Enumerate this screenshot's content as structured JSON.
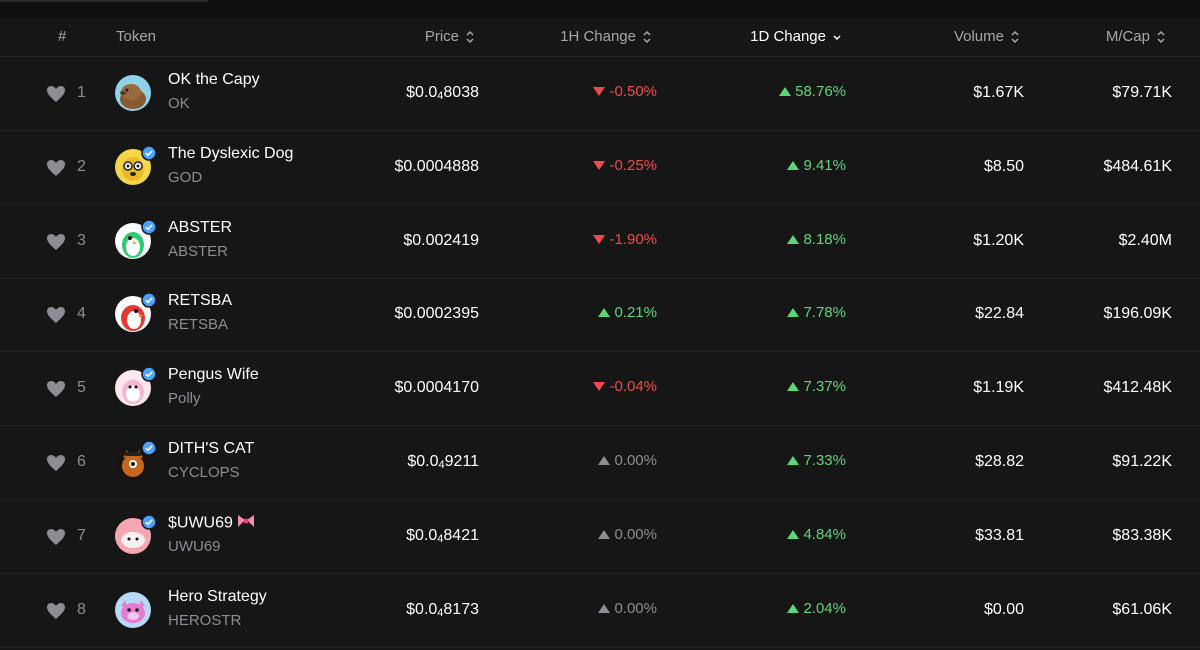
{
  "header": {
    "rank": "#",
    "token": "Token",
    "price": "Price",
    "change_1h": "1H Change",
    "change_1d": "1D Change",
    "volume": "Volume",
    "mcap": "M/Cap"
  },
  "colors": {
    "positive": "#5fd57a",
    "negative": "#f04a4a",
    "neutral": "#8d8d94",
    "verified": "#4aa3ff"
  },
  "rows": [
    {
      "rank": "1",
      "name": "OK the Capy",
      "symbol": "OK",
      "price_main": "$0.0",
      "price_sub": "4",
      "price_tail": "8038",
      "change_1h": "-0.50%",
      "change_1h_dir": "down",
      "change_1d": "58.76%",
      "change_1d_dir": "up",
      "volume": "$1.67K",
      "mcap": "$79.71K",
      "avatar_icon": "capybara-icon",
      "verified": false
    },
    {
      "rank": "2",
      "name": "The Dyslexic Dog",
      "symbol": "GOD",
      "price_main": "$0.0004888",
      "price_sub": "",
      "price_tail": "",
      "change_1h": "-0.25%",
      "change_1h_dir": "down",
      "change_1d": "9.41%",
      "change_1d_dir": "up",
      "volume": "$8.50",
      "mcap": "$484.61K",
      "avatar_icon": "dog-icon",
      "verified": true
    },
    {
      "rank": "3",
      "name": "ABSTER",
      "symbol": "ABSTER",
      "price_main": "$0.002419",
      "price_sub": "",
      "price_tail": "",
      "change_1h": "-1.90%",
      "change_1h_dir": "down",
      "change_1d": "8.18%",
      "change_1d_dir": "up",
      "volume": "$1.20K",
      "mcap": "$2.40M",
      "avatar_icon": "green-penguin-icon",
      "verified": true
    },
    {
      "rank": "4",
      "name": "RETSBA",
      "symbol": "RETSBA",
      "price_main": "$0.0002395",
      "price_sub": "",
      "price_tail": "",
      "change_1h": "0.21%",
      "change_1h_dir": "up",
      "change_1d": "7.78%",
      "change_1d_dir": "up",
      "volume": "$22.84",
      "mcap": "$196.09K",
      "avatar_icon": "red-penguin-icon",
      "verified": true
    },
    {
      "rank": "5",
      "name": "Pengus Wife",
      "symbol": "Polly",
      "price_main": "$0.0004170",
      "price_sub": "",
      "price_tail": "",
      "change_1h": "-0.04%",
      "change_1h_dir": "down",
      "change_1d": "7.37%",
      "change_1d_dir": "up",
      "volume": "$1.19K",
      "mcap": "$412.48K",
      "avatar_icon": "pink-penguin-icon",
      "verified": true
    },
    {
      "rank": "6",
      "name": "DITH'S CAT",
      "symbol": "CYCLOPS",
      "price_main": "$0.0",
      "price_sub": "4",
      "price_tail": "9211",
      "change_1h": "0.00%",
      "change_1h_dir": "flat",
      "change_1d": "7.33%",
      "change_1d_dir": "up",
      "volume": "$28.82",
      "mcap": "$91.22K",
      "avatar_icon": "cat-icon",
      "verified": true
    },
    {
      "rank": "7",
      "name": "$UWU69",
      "symbol": "UWU69",
      "price_main": "$0.0",
      "price_sub": "4",
      "price_tail": "8421",
      "change_1h": "0.00%",
      "change_1h_dir": "flat",
      "change_1d": "4.84%",
      "change_1d_dir": "up",
      "volume": "$33.81",
      "mcap": "$83.38K",
      "avatar_icon": "pink-blob-icon",
      "verified": true,
      "name_suffix_icon": "bow-icon"
    },
    {
      "rank": "8",
      "name": "Hero Strategy",
      "symbol": "HEROSTR",
      "price_main": "$0.0",
      "price_sub": "4",
      "price_tail": "8173",
      "change_1h": "0.00%",
      "change_1h_dir": "flat",
      "change_1d": "2.04%",
      "change_1d_dir": "up",
      "volume": "$0.00",
      "mcap": "$61.06K",
      "avatar_icon": "pink-creature-icon",
      "verified": false
    }
  ]
}
